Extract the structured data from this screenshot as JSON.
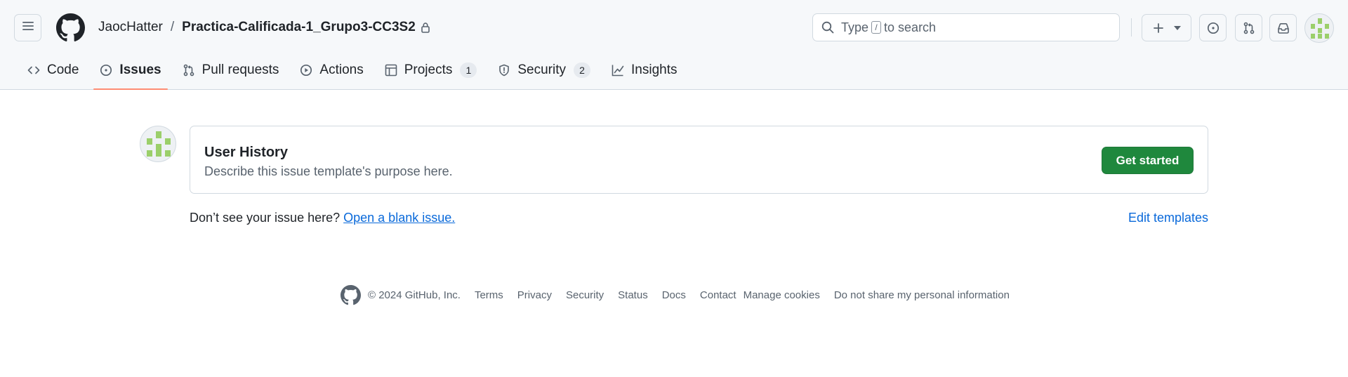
{
  "header": {
    "owner": "JaocHatter",
    "separator": "/",
    "repo": "Practica-Calificada-1_Grupo3-CC3S2",
    "search": {
      "prefix": "Type",
      "key": "/",
      "suffix": "to search"
    }
  },
  "icons": {
    "menu": "hamburger-icon",
    "logo": "github-mark-icon",
    "lock": "lock-icon",
    "search": "search-icon",
    "create": "plus-icon",
    "caret": "triangle-down-icon",
    "issues": "issue-opened-icon",
    "pull_requests": "git-pull-request-icon",
    "inbox": "inbox-icon"
  },
  "tabs": [
    {
      "label": "Code",
      "icon": "code-icon"
    },
    {
      "label": "Issues",
      "icon": "issue-opened-icon",
      "selected": true
    },
    {
      "label": "Pull requests",
      "icon": "git-pull-request-icon"
    },
    {
      "label": "Actions",
      "icon": "play-icon"
    },
    {
      "label": "Projects",
      "icon": "table-icon",
      "count": "1"
    },
    {
      "label": "Security",
      "icon": "shield-icon",
      "count": "2"
    },
    {
      "label": "Insights",
      "icon": "graph-icon"
    }
  ],
  "template": {
    "name": "User History",
    "description": "Describe this issue template's purpose here.",
    "button": "Get started"
  },
  "blank_issue": {
    "prompt": "Don’t see your issue here?",
    "link": "Open a blank issue."
  },
  "edit_templates": "Edit templates",
  "footer": {
    "copyright": "© 2024 GitHub, Inc.",
    "links": [
      "Terms",
      "Privacy",
      "Security",
      "Status",
      "Docs",
      "Contact",
      "Manage cookies",
      "Do not share my personal information"
    ]
  },
  "colors": {
    "primary_button": "#1f883d",
    "link": "#0969da",
    "selected_tab_underline": "#fd8c73",
    "identicon": "#9bcf6a"
  }
}
